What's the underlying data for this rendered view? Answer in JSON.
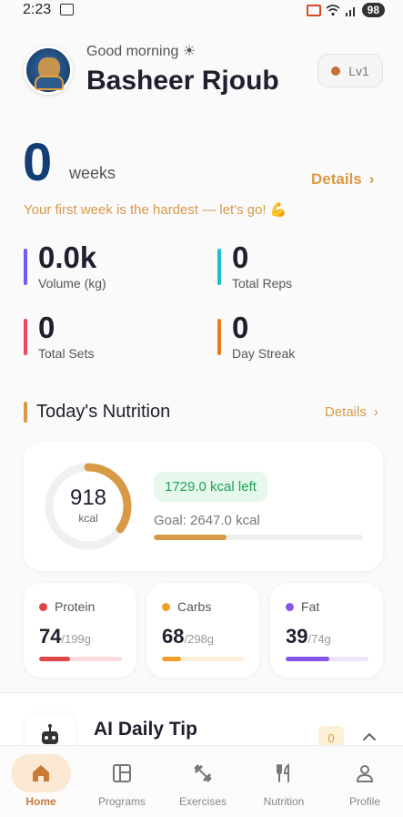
{
  "status_bar": {
    "time": "2:23",
    "battery": "98"
  },
  "header": {
    "greeting": "Good morning ☀",
    "username": "Basheer Rjoub",
    "level": "Lv1"
  },
  "streak": {
    "weeks_value": "0",
    "weeks_label": "weeks",
    "details_label": "Details",
    "motivation": "Your first week is the hardest — let's go! 💪"
  },
  "stats": [
    {
      "value": "0.0k",
      "label": "Volume (kg)",
      "color": "#6b5cf2"
    },
    {
      "value": "0",
      "label": "Total Reps",
      "color": "#1ec0cc"
    },
    {
      "value": "0",
      "label": "Total Sets",
      "color": "#ee4562"
    },
    {
      "value": "0",
      "label": "Day Streak",
      "color": "#ee7a1a"
    }
  ],
  "nutrition": {
    "title": "Today's Nutrition",
    "details_label": "Details",
    "consumed": "918",
    "consumed_unit": "kcal",
    "left_text": "1729.0 kcal left",
    "goal_text": "Goal: 2647.0 kcal",
    "progress_fraction": 0.347,
    "accent_color": "#d89a46",
    "macros": [
      {
        "name": "Protein",
        "value": "74",
        "goal": "/199g",
        "fraction": 0.372,
        "color": "#e04646",
        "track": "#fadcdc"
      },
      {
        "name": "Carbs",
        "value": "68",
        "goal": "/298g",
        "fraction": 0.228,
        "color": "#f0a02a",
        "track": "#fcefd8"
      },
      {
        "name": "Fat",
        "value": "39",
        "goal": "/74g",
        "fraction": 0.527,
        "color": "#8455e8",
        "track": "#ece4fb"
      }
    ]
  },
  "tip": {
    "title": "AI Daily Tip",
    "count": "0"
  },
  "nav": [
    {
      "label": "Home",
      "icon": "home-icon",
      "active": true
    },
    {
      "label": "Programs",
      "icon": "programs-icon",
      "active": false
    },
    {
      "label": "Exercises",
      "icon": "dumbbell-icon",
      "active": false
    },
    {
      "label": "Nutrition",
      "icon": "fork-knife-icon",
      "active": false
    },
    {
      "label": "Profile",
      "icon": "user-icon",
      "active": false
    }
  ]
}
